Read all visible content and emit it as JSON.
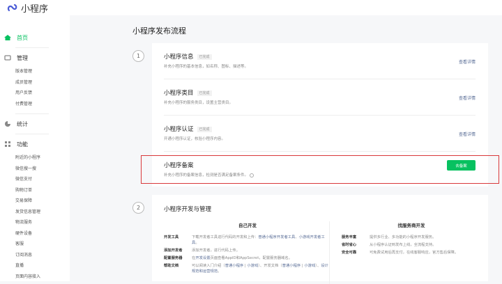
{
  "header": {
    "logo": "小程序"
  },
  "sidebar": {
    "home": "首页",
    "manage": {
      "label": "管理",
      "items": [
        "版本管理",
        "成员管理",
        "用户反馈",
        "付费管理"
      ]
    },
    "stats": {
      "label": "统计"
    },
    "features": {
      "label": "功能",
      "items": [
        "附近的小程序",
        "微信搜一搜",
        "微信支付",
        "购物订单",
        "交易保障",
        "发货信息管理",
        "物流服务",
        "硬件设备",
        "客服",
        "订阅消息",
        "直播",
        "页面内容接入"
      ]
    }
  },
  "main": {
    "title": "小程序发布流程",
    "step1": "1",
    "step2": "2",
    "items": [
      {
        "title": "小程序信息",
        "badge": "已完成",
        "desc": "补充小程序的基本信息，如名称、图标、描述等。",
        "link": "查看详情"
      },
      {
        "title": "小程序类目",
        "badge": "已完成",
        "desc": "补充小程序的服务类目，设置主营类目。",
        "link": "查看详情"
      },
      {
        "title": "小程序认证",
        "badge": "已完成",
        "desc": "开通小程序认证，核验小程序内容。",
        "link": "查看详情"
      },
      {
        "title": "小程序备案",
        "desc": "补充小程序的备案信息，检测是否满足备案条件。",
        "button": "去备案"
      }
    ],
    "dev": {
      "title": "小程序开发与管理",
      "self": {
        "heading": "自己开发",
        "rows": [
          {
            "k": "开发工具",
            "v": "下载开发者工具进行代码的开发和上传：",
            "l1": "普通小程序开发者工具",
            "sep": "、",
            "l2": "小游戏开发者工具",
            "end": "。"
          },
          {
            "k": "添加开发者",
            "v": "添加开发者，进行代码上传。"
          },
          {
            "k": "配置服务器",
            "v1": "在",
            "l": "开发设置",
            "v2": "页面查看AppID和AppSecret，配置服务器域名。"
          },
          {
            "k": "帮助文档",
            "v": "可以阅读入门介绍（",
            "l1": "普通小程序",
            "s1": " | ",
            "l2": "小游戏",
            "v2": "）、开发文档（",
            "l3": "普通小程序",
            "s2": " | ",
            "l4": "小游戏",
            "v3": "）、",
            "l5": "设计规范和运营规范",
            "end": "。"
          }
        ]
      },
      "vendor": {
        "heading": "找服务商开发",
        "rows": [
          {
            "k": "服务丰富",
            "v": "提供多行业、多功能的小程序开发服务。"
          },
          {
            "k": "省时省心",
            "v": "从小程序认证到发布上线，全流程支持。"
          },
          {
            "k": "安全可靠",
            "v": "可免费试用后再支付，在线客服响应，官方售后保障。"
          }
        ]
      }
    }
  },
  "colors": {
    "accent": "#07c160",
    "highlight": "#d9383a",
    "link": "#576b95"
  }
}
